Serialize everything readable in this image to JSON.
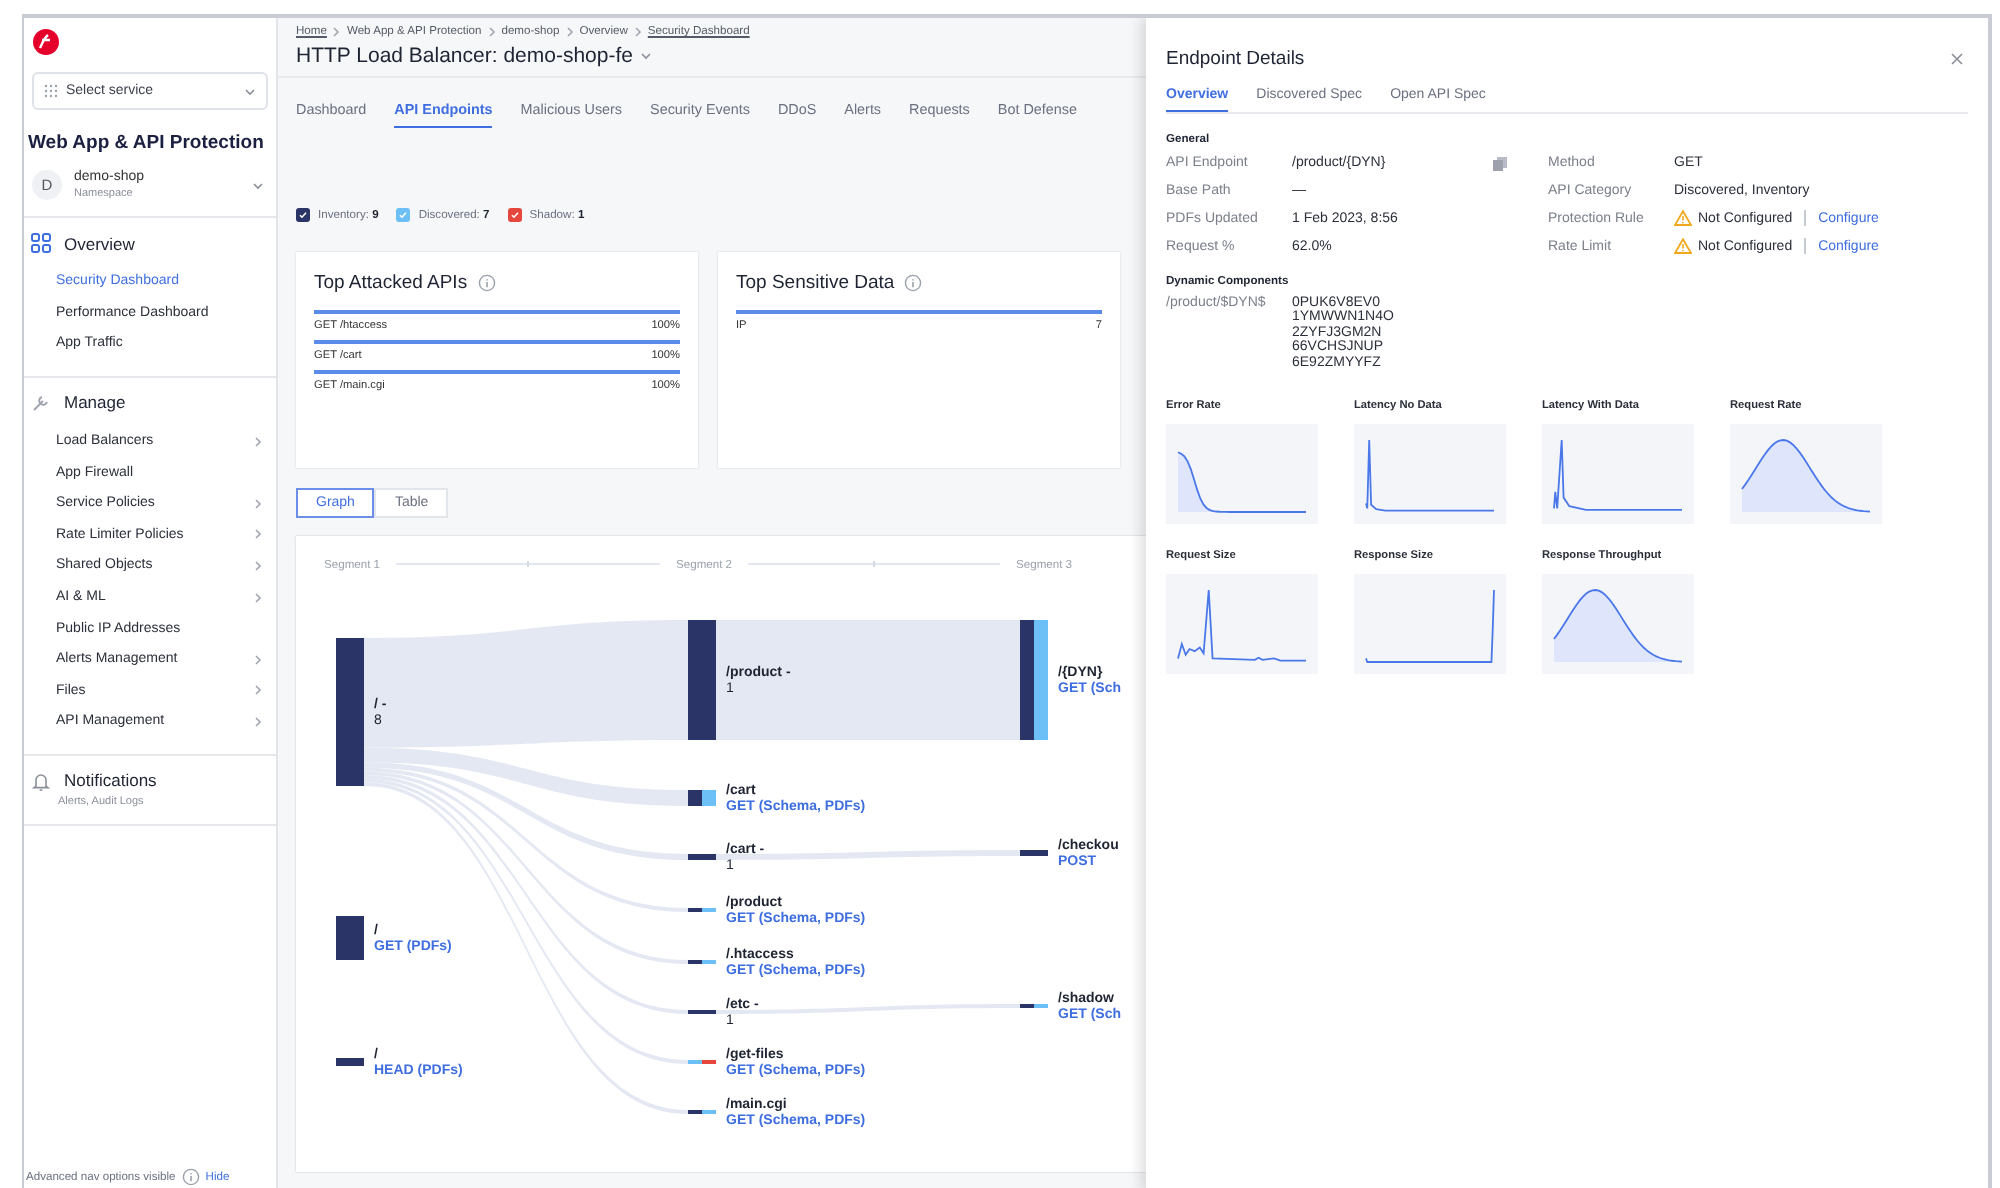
{
  "sidebar": {
    "service_select": {
      "placeholder": "Select service"
    },
    "app_title": "Web App & API Protection",
    "namespace": {
      "avatar": "D",
      "name": "demo-shop",
      "caption": "Namespace"
    },
    "sections": [
      {
        "title": "Overview",
        "items": [
          {
            "label": "Security Dashboard",
            "selected": true,
            "has_submenu": false
          },
          {
            "label": "Performance Dashboard",
            "selected": false,
            "has_submenu": false
          },
          {
            "label": "App Traffic",
            "selected": false,
            "has_submenu": false
          }
        ]
      },
      {
        "title": "Manage",
        "items": [
          {
            "label": "Load Balancers",
            "selected": false,
            "has_submenu": true
          },
          {
            "label": "App Firewall",
            "selected": false,
            "has_submenu": false
          },
          {
            "label": "Service Policies",
            "selected": false,
            "has_submenu": true
          },
          {
            "label": "Rate Limiter Policies",
            "selected": false,
            "has_submenu": true
          },
          {
            "label": "Shared Objects",
            "selected": false,
            "has_submenu": true
          },
          {
            "label": "AI & ML",
            "selected": false,
            "has_submenu": true
          },
          {
            "label": "Public IP Addresses",
            "selected": false,
            "has_submenu": false
          },
          {
            "label": "Alerts Management",
            "selected": false,
            "has_submenu": true
          },
          {
            "label": "Files",
            "selected": false,
            "has_submenu": true
          },
          {
            "label": "API Management",
            "selected": false,
            "has_submenu": true
          }
        ]
      },
      {
        "title": "Notifications",
        "subtitle": "Alerts, Audit Logs"
      }
    ],
    "footer": {
      "text": "Advanced nav options visible",
      "link": "Hide"
    }
  },
  "breadcrumb": [
    {
      "label": "Home",
      "link": true
    },
    {
      "label": "Web App & API Protection",
      "link": false
    },
    {
      "label": "demo-shop",
      "link": false
    },
    {
      "label": "Overview",
      "link": false
    },
    {
      "label": "Security Dashboard",
      "link": true
    }
  ],
  "page_title": "HTTP Load Balancer: demo-shop-fe",
  "tabs": [
    {
      "label": "Dashboard",
      "selected": false
    },
    {
      "label": "API Endpoints",
      "selected": true
    },
    {
      "label": "Malicious Users",
      "selected": false
    },
    {
      "label": "Security Events",
      "selected": false
    },
    {
      "label": "DDoS",
      "selected": false
    },
    {
      "label": "Alerts",
      "selected": false
    },
    {
      "label": "Requests",
      "selected": false
    },
    {
      "label": "Bot Defense",
      "selected": false
    }
  ],
  "legend": [
    {
      "label": "Inventory: **9**",
      "kind": "inventory",
      "checked": true,
      "color": "#2b3467"
    },
    {
      "label": "Discovered: **7**",
      "kind": "discovered",
      "checked": true,
      "color": "#6cc0f5"
    },
    {
      "label": "Shadow: **1**",
      "kind": "shadow",
      "checked": true,
      "color": "#e5473c"
    }
  ],
  "cards": [
    {
      "title": "Top Attacked APIs",
      "rows": [
        {
          "label": "GET /htaccess",
          "value": "100%",
          "level": 1
        },
        {
          "label": "GET /cart",
          "value": "100%",
          "level": 1
        },
        {
          "label": "GET /main.cgi",
          "value": "100%",
          "level": 1
        }
      ]
    },
    {
      "title": "Top Sensitive Data",
      "rows": [
        {
          "label": "IP",
          "value": "7",
          "level": 1
        }
      ]
    }
  ],
  "view_toggle": [
    {
      "label": "Graph",
      "selected": true
    },
    {
      "label": "Table",
      "selected": false
    }
  ],
  "flow": {
    "segments": [
      "Segment 1",
      "Segment 2",
      "Segment 3"
    ],
    "nodes": [
      {
        "path": "/ -",
        "detail": "8",
        "kind": "count",
        "inventory": true,
        "discovered": false,
        "shadow": false,
        "children": [
          {
            "path": "/product -",
            "detail": "1",
            "kind": "count",
            "inventory": true,
            "discovered": false,
            "shadow": false,
            "children": [
              {
                "path": "/{DYN}",
                "detail": "GET (Sch",
                "kind": "methods",
                "inventory": true,
                "discovered": true,
                "shadow": false
              }
            ]
          },
          {
            "path": "/cart",
            "detail": "GET (Schema, PDFs)",
            "kind": "methods",
            "inventory": true,
            "discovered": true,
            "shadow": false
          },
          {
            "path": "/cart -",
            "detail": "1",
            "kind": "count",
            "inventory": true,
            "discovered": false,
            "shadow": false,
            "children": [
              {
                "path": "/checkou",
                "detail": "POST",
                "kind": "methods",
                "inventory": true,
                "discovered": false,
                "shadow": false
              }
            ]
          },
          {
            "path": "/product",
            "detail": "GET (Schema, PDFs)",
            "kind": "methods",
            "inventory": true,
            "discovered": true,
            "shadow": false
          },
          {
            "path": "/.htaccess",
            "detail": "GET (Schema, PDFs)",
            "kind": "methods",
            "inventory": true,
            "discovered": true,
            "shadow": false
          },
          {
            "path": "/etc -",
            "detail": "1",
            "kind": "count",
            "inventory": true,
            "discovered": false,
            "shadow": false,
            "children": [
              {
                "path": "/shadow",
                "detail": "GET (Sch",
                "kind": "methods",
                "inventory": true,
                "discovered": true,
                "shadow": false
              }
            ]
          },
          {
            "path": "/get-files",
            "detail": "GET (Schema, PDFs)",
            "kind": "methods",
            "inventory": false,
            "discovered": true,
            "shadow": true
          },
          {
            "path": "/main.cgi",
            "detail": "GET (Schema, PDFs)",
            "kind": "methods",
            "inventory": true,
            "discovered": true,
            "shadow": false
          }
        ]
      },
      {
        "path": "/",
        "detail": "GET (PDFs)",
        "kind": "methods",
        "inventory": true,
        "discovered": false,
        "shadow": false
      },
      {
        "path": "/",
        "detail": "HEAD (PDFs)",
        "kind": "methods",
        "inventory": true,
        "discovered": false,
        "shadow": false
      }
    ]
  },
  "panel": {
    "title": "Endpoint Details",
    "tabs": [
      {
        "label": "Overview",
        "selected": true
      },
      {
        "label": "Discovered Spec",
        "selected": false
      },
      {
        "label": "Open API Spec",
        "selected": false
      }
    ],
    "general": {
      "title": "General",
      "left": [
        {
          "label": "API Endpoint",
          "value": "/product/{DYN}",
          "copyable": true
        },
        {
          "label": "Base Path",
          "value": "—",
          "copyable": false
        },
        {
          "label": "PDFs Updated",
          "value": "1 Feb 2023, 8:56",
          "copyable": false
        },
        {
          "label": "Request %",
          "value": "62.0%",
          "copyable": false
        }
      ],
      "right": [
        {
          "label": "Method",
          "value": "GET",
          "warning": false
        },
        {
          "label": "API Category",
          "value": "Discovered, Inventory",
          "warning": false
        },
        {
          "label": "Protection Rule",
          "value": "Not Configured",
          "warning": true,
          "action": "Configure"
        },
        {
          "label": "Rate Limit",
          "value": "Not Configured",
          "warning": true,
          "action": "Configure"
        }
      ]
    },
    "dynamic": {
      "title": "Dynamic Components",
      "path": "/product/$DYN$",
      "values": [
        "0PUK6V8EV0",
        "1YMWWN1N4O",
        "2ZYFJ3GM2N",
        "66VCHSJNUP",
        "6E92ZMYYFZ"
      ]
    },
    "metrics": [
      {
        "title": "Error Rate",
        "kind": "decay"
      },
      {
        "title": "Latency No Data",
        "kind": "spike"
      },
      {
        "title": "Latency With Data",
        "kind": "doublespike"
      },
      {
        "title": "Request Rate",
        "kind": "bell"
      },
      {
        "title": "Request Size",
        "kind": "noisy"
      },
      {
        "title": "Response Size",
        "kind": "latespike"
      },
      {
        "title": "Response Throughput",
        "kind": "bell"
      }
    ]
  }
}
